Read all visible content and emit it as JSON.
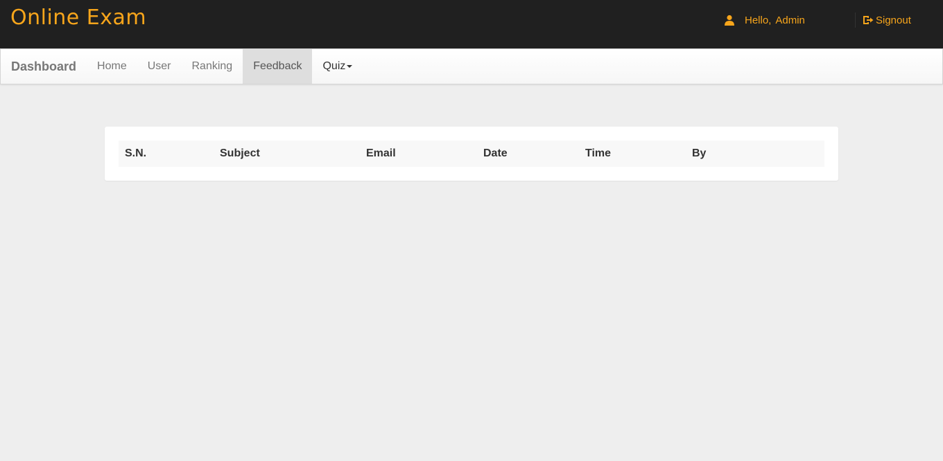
{
  "header": {
    "brand": "Online Exam",
    "greeting": "Hello,",
    "username": "Admin",
    "signout_label": "Signout",
    "accent_color": "#f7a51b"
  },
  "navbar": {
    "brand": "Dashboard",
    "items": [
      {
        "label": "Home",
        "icon": null
      },
      {
        "label": "User",
        "icon": null
      },
      {
        "label": "Ranking",
        "icon": null
      },
      {
        "label": "Feedback",
        "active": true
      },
      {
        "label": "Quiz",
        "icon": "caret-down-icon"
      }
    ]
  },
  "feedback_table": {
    "columns": [
      "S.N.",
      "Subject",
      "Email",
      "Date",
      "Time",
      "By"
    ],
    "rows": []
  }
}
